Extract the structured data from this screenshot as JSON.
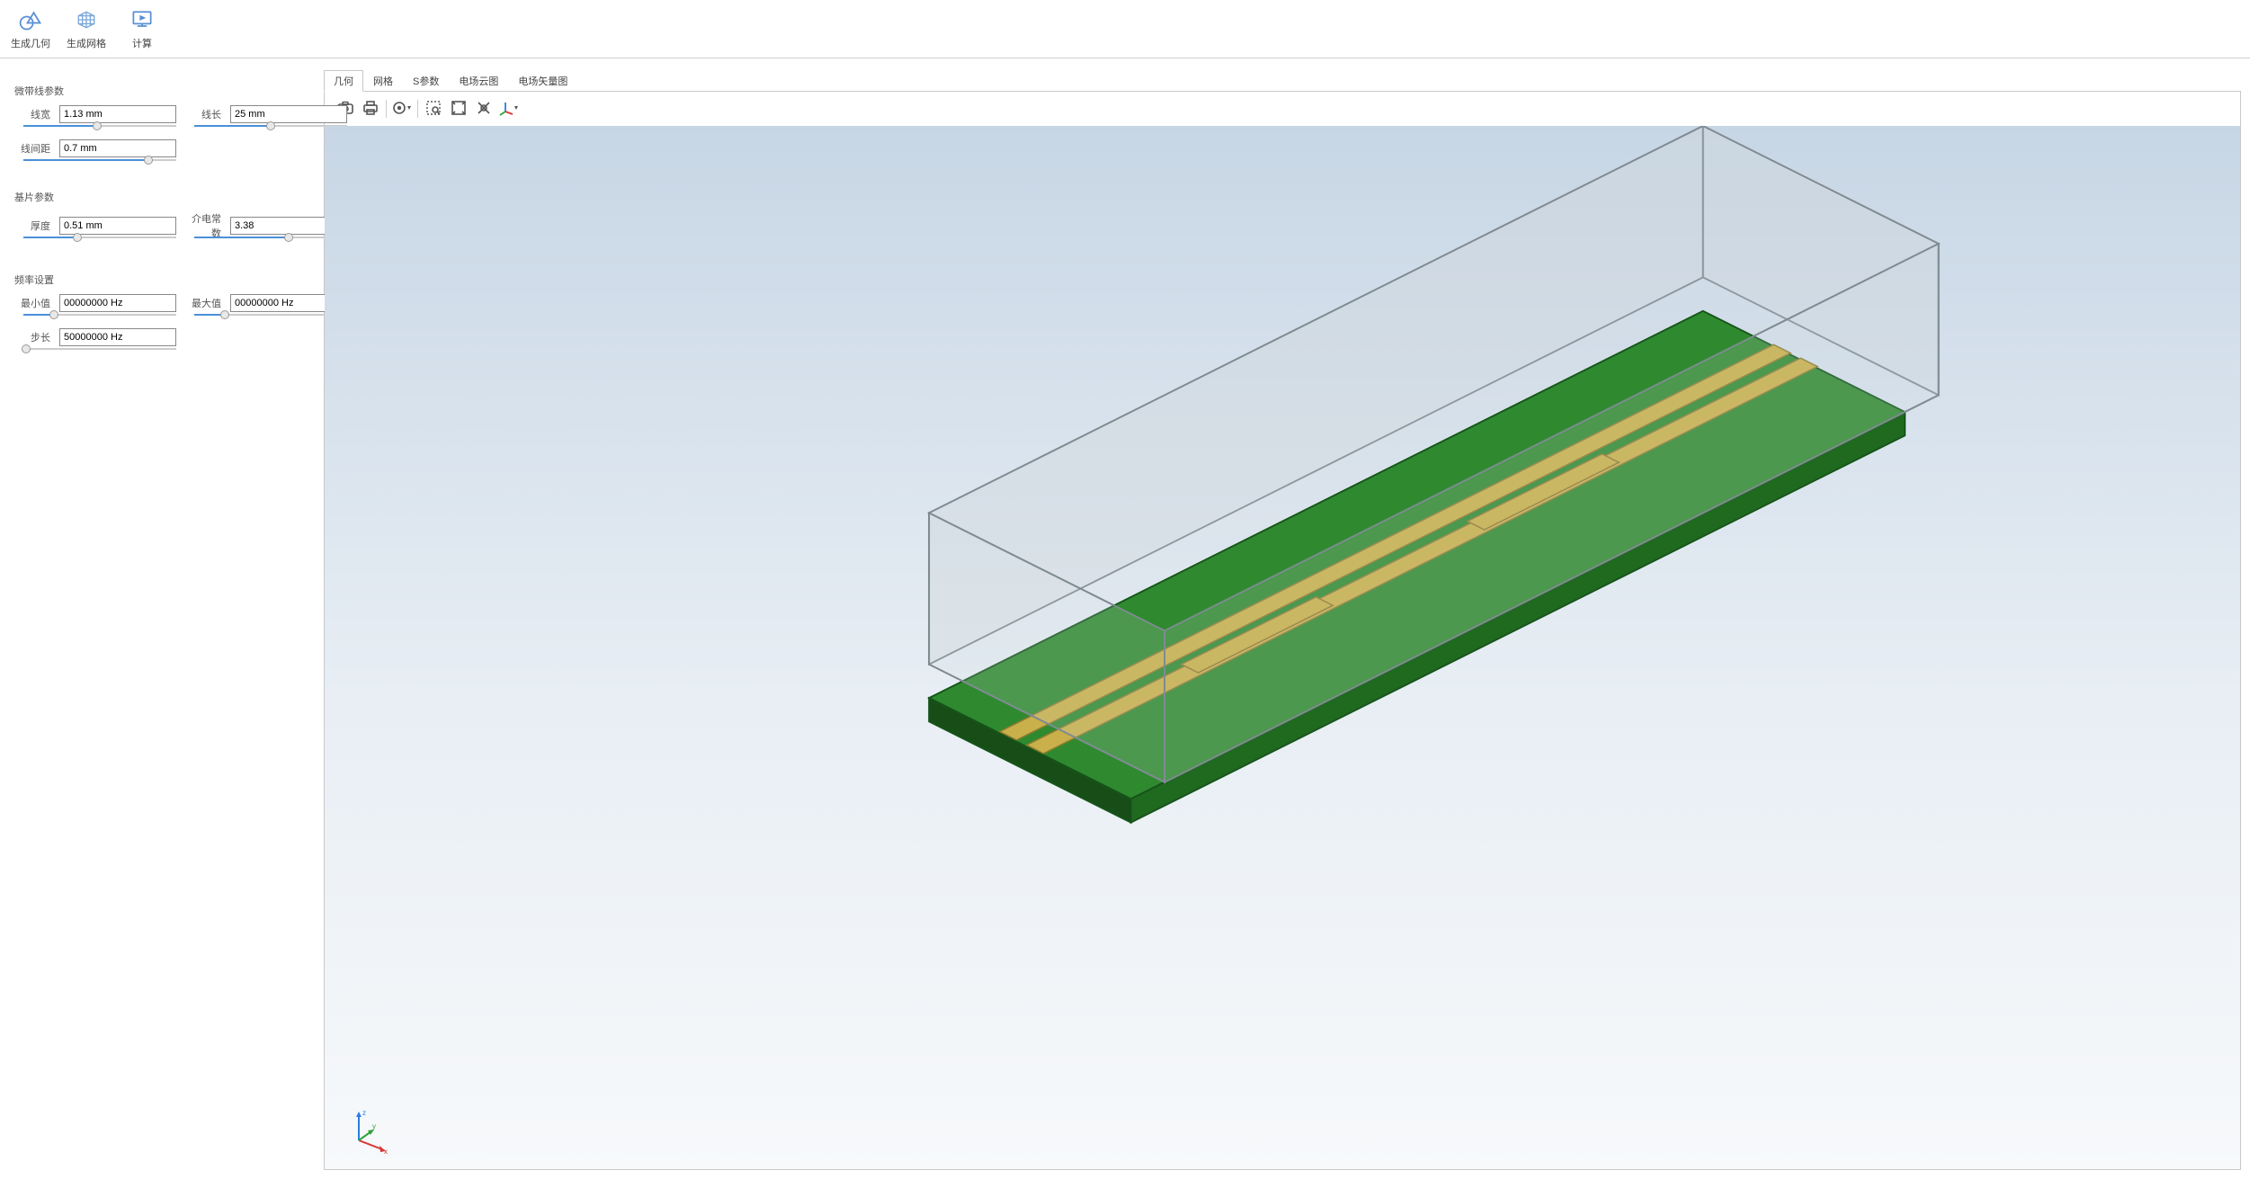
{
  "toolbar": {
    "generate_geometry": "生成几何",
    "generate_mesh": "生成网格",
    "compute": "计算"
  },
  "sections": {
    "microstrip": {
      "title": "微带线参数",
      "line_width_label": "线宽",
      "line_width_value": "1.13 mm",
      "line_length_label": "线长",
      "line_length_value": "25 mm",
      "line_spacing_label": "线间距",
      "line_spacing_value": "0.7 mm"
    },
    "substrate": {
      "title": "基片参数",
      "thickness_label": "厚度",
      "thickness_value": "0.51 mm",
      "permittivity_label": "介电常数",
      "permittivity_value": "3.38"
    },
    "frequency": {
      "title": "频率设置",
      "min_label": "最小值",
      "min_value": "00000000 Hz",
      "max_label": "最大值",
      "max_value": "00000000 Hz",
      "step_label": "步长",
      "step_value": "50000000 Hz"
    }
  },
  "tabs": {
    "geometry": "几何",
    "mesh": "网格",
    "sparams": "S参数",
    "efield_cloud": "电场云图",
    "efield_vector": "电场矢量图"
  },
  "axes": {
    "x": "x",
    "y": "y",
    "z": "z"
  },
  "colors": {
    "accent": "#4a90d9",
    "pcb_green": "#2f8a2f",
    "pcb_green_dark": "#1f6a1f",
    "trace_gold": "#c9b04a",
    "box_gray": "#bcc3c8"
  }
}
